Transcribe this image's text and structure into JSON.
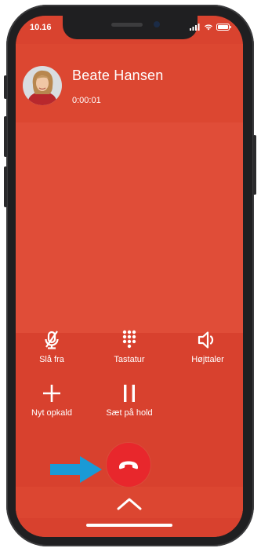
{
  "status_bar": {
    "time": "10.16",
    "icons": [
      "signal-icon",
      "wifi-icon",
      "battery-icon"
    ]
  },
  "caller": {
    "name": "Beate Hansen",
    "duration": "0:00:01",
    "avatar_icon": "avatar"
  },
  "controls": {
    "mute": {
      "label": "Slå fra",
      "icon": "microphone-off-icon"
    },
    "keypad": {
      "label": "Tastatur",
      "icon": "keypad-icon"
    },
    "speaker": {
      "label": "Højttaler",
      "icon": "speaker-icon"
    },
    "add_call": {
      "label": "Nyt opkald",
      "icon": "plus-icon"
    },
    "hold": {
      "label": "Sæt på hold",
      "icon": "pause-icon"
    }
  },
  "hangup": {
    "icon": "phone-hangup-icon"
  },
  "annotation": {
    "icon": "arrow-right-icon",
    "color": "#1a9ad6"
  },
  "bottom": {
    "icon": "chevron-up-icon"
  },
  "colors": {
    "background": "#d9432f",
    "hangup": "#e8272c",
    "text": "#ffffff"
  }
}
